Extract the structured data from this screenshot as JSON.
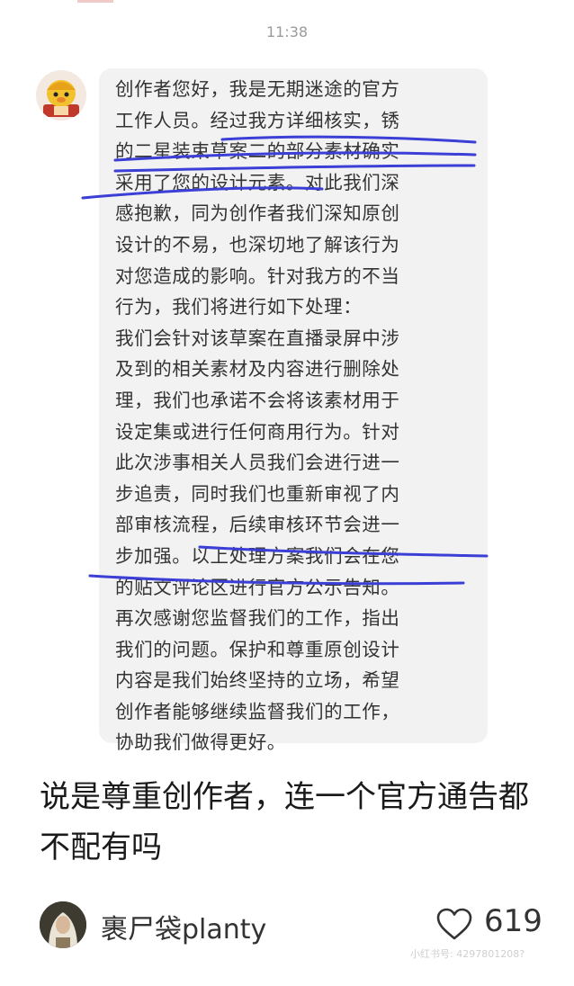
{
  "chat": {
    "time": "11:38",
    "message": "创作者您好，我是无期迷途的官方\n工作人员。经过我方详细核实，锈\n的二星装束草案二的部分素材确实\n采用了您的设计元素。对此我们深\n感抱歉，同为创作者我们深知原创\n设计的不易，也深切地了解该行为\n对您造成的影响。针对我方的不当\n行为，我们将进行如下处理：\n我们会针对该草案在直播录屏中涉\n及到的相关素材及内容进行删除处\n理，我们也承诺不会将该素材用于\n设定集或进行任何商用行为。针对\n此次涉事相关人员我们会进行进一\n步追责，同时我们也重新审视了内\n部审核流程，后续审核环节会进一\n步加强。以上处理方案我们会在您\n的贴文评论区进行官方公示告知。\n再次感谢您监督我们的工作，指出\n我们的问题。保护和尊重原创设计\n内容是我们始终坚持的立场，希望\n创作者能够继续监督我们的工作，\n协助我们做得更好。",
    "sender_avatar_icon": "mascot-avatar",
    "underline_color": "#3b3fd6"
  },
  "post": {
    "caption": "说是尊重创作者，连一个官方通告都不配有吗",
    "author": "裹尸袋planty",
    "author_avatar_icon": "portrait-avatar",
    "like_icon": "heart-outline-icon",
    "likes": "619",
    "watermark": "小红书号: 4297801208?"
  }
}
